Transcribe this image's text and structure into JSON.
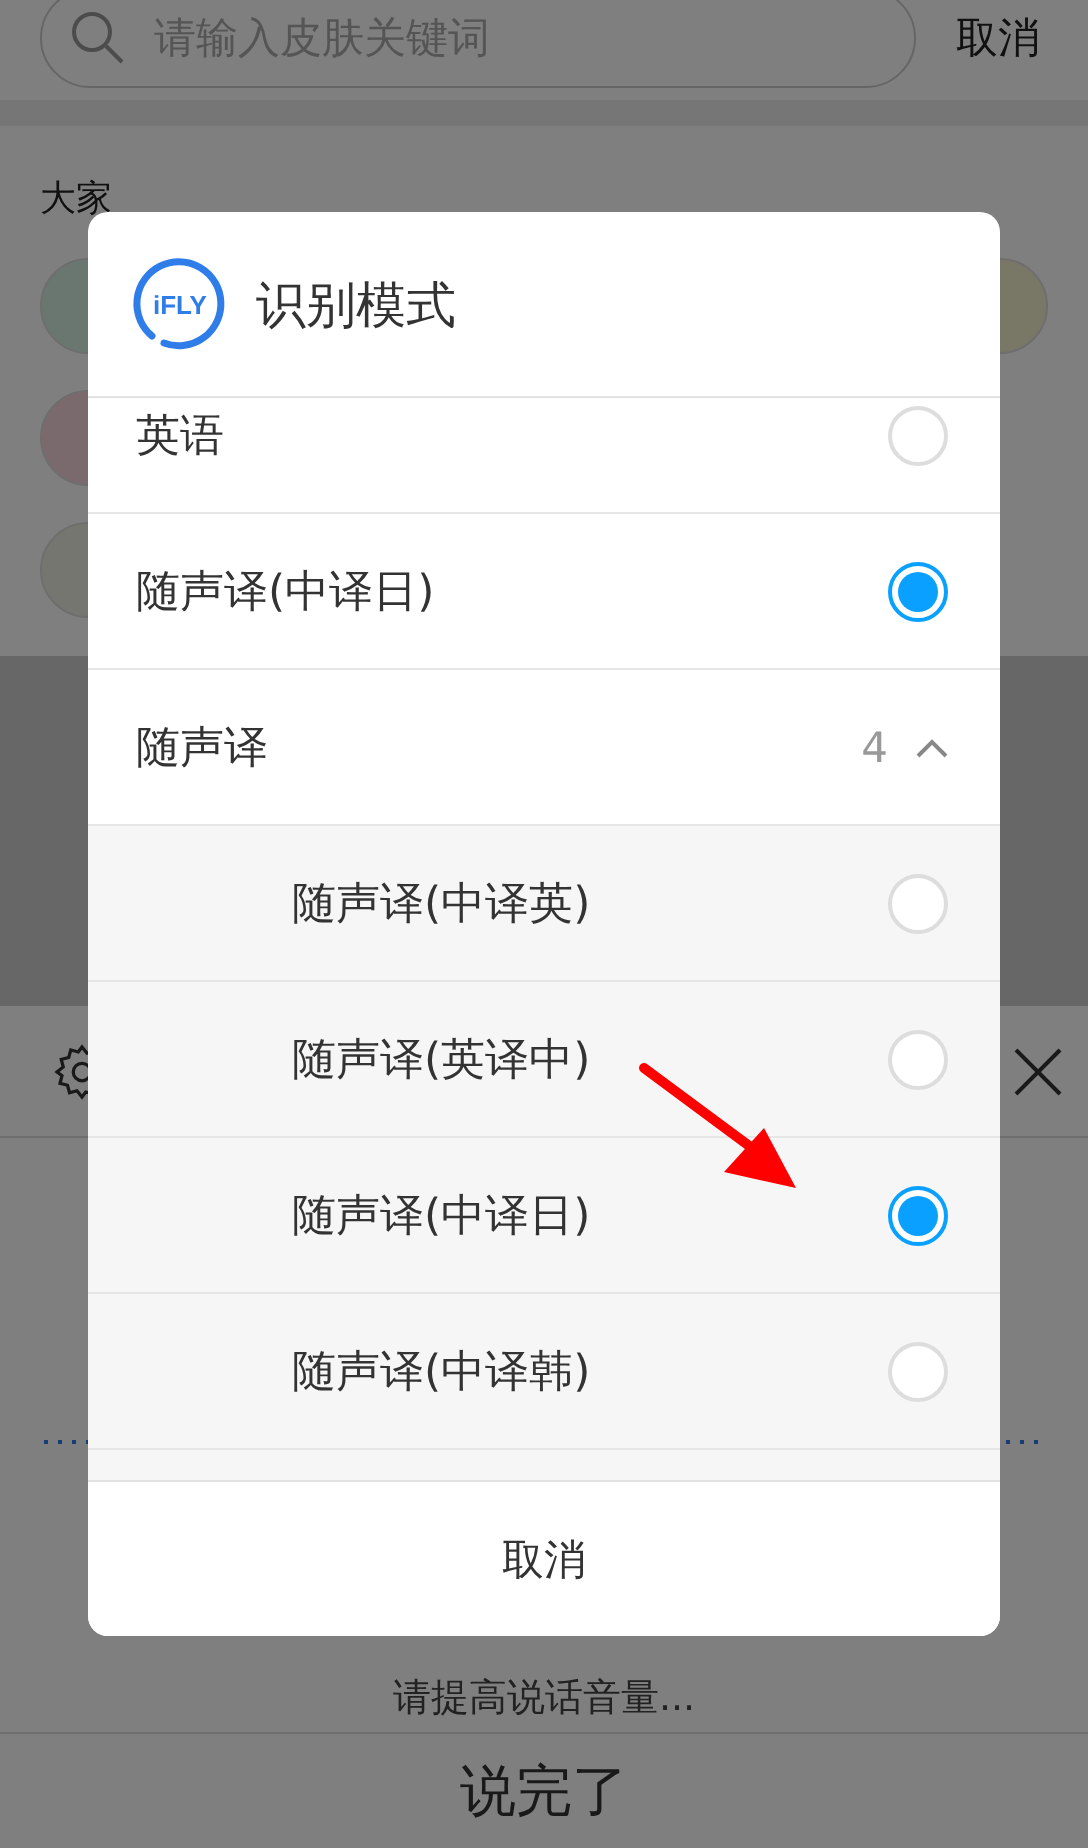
{
  "search": {
    "placeholder": "请输入皮肤关键词",
    "cancel": "取消"
  },
  "hot_searches": {
    "title": "大家"
  },
  "voice_panel": {
    "hint": "请提高说话音量...",
    "done_button": "说完了"
  },
  "dialog": {
    "logo": "iFLY",
    "title": "识别模式",
    "options": [
      {
        "label": "英语",
        "selected": false
      },
      {
        "label": "随声译(中译日)",
        "selected": true
      },
      {
        "label": "随声译",
        "count": "4",
        "expanded": true,
        "children": [
          {
            "label": "随声译(中译英)",
            "selected": false
          },
          {
            "label": "随声译(英译中)",
            "selected": false
          },
          {
            "label": "随声译(中译日)",
            "selected": true
          },
          {
            "label": "随声译(中译韩)",
            "selected": false
          }
        ]
      }
    ],
    "cancel_button": "取消"
  }
}
